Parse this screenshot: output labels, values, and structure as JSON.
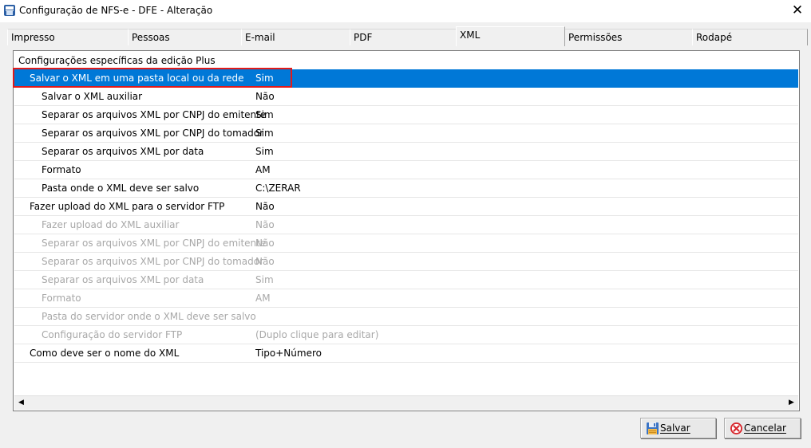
{
  "window": {
    "title": "Configuração de NFS-e - DFE - Alteração"
  },
  "tabs": [
    {
      "label": "Impresso"
    },
    {
      "label": "Pessoas"
    },
    {
      "label": "E-mail"
    },
    {
      "label": "PDF"
    },
    {
      "label": "XML"
    },
    {
      "label": "Permissões"
    },
    {
      "label": "Rodapé"
    }
  ],
  "active_tab": "XML",
  "panel": {
    "title": "Configurações específicas da edição Plus",
    "rows": [
      {
        "label": "Salvar o XML em uma pasta local ou da rede",
        "value": "Sim"
      },
      {
        "label": "Salvar o XML auxiliar",
        "value": "Não"
      },
      {
        "label": "Separar os arquivos XML por CNPJ do emitente",
        "value": "Sim"
      },
      {
        "label": "Separar os arquivos XML por CNPJ do tomador",
        "value": "Sim"
      },
      {
        "label": "Separar os arquivos XML por data",
        "value": "Sim"
      },
      {
        "label": "Formato",
        "value": "AM"
      },
      {
        "label": "Pasta onde o XML deve ser salvo",
        "value": "C:\\ZERAR"
      },
      {
        "label": "Fazer upload do XML para o servidor FTP",
        "value": "Não"
      },
      {
        "label": "Fazer upload do XML auxiliar",
        "value": "Não"
      },
      {
        "label": "Separar os arquivos XML por CNPJ do emitente",
        "value": "Não"
      },
      {
        "label": "Separar os arquivos XML por CNPJ do tomador",
        "value": "Não"
      },
      {
        "label": "Separar os arquivos XML por data",
        "value": "Sim"
      },
      {
        "label": "Formato",
        "value": "AM"
      },
      {
        "label": "Pasta do servidor onde o XML deve ser salvo",
        "value": ""
      },
      {
        "label": "Configuração do servidor FTP",
        "value": "(Duplo clique para editar)"
      },
      {
        "label": "Como deve ser o nome do XML",
        "value": "Tipo+Número"
      }
    ]
  },
  "buttons": {
    "save_label": "Salvar",
    "cancel_label": "Cancelar"
  },
  "colors": {
    "selection": "#0078d7",
    "highlight_border": "#e01a1a",
    "disabled_text": "#a8a8a8"
  },
  "icons": {
    "app": "app-icon",
    "close": "close-icon",
    "save": "floppy-disk-icon",
    "cancel": "cancel-icon",
    "scroll_left": "arrow-left-icon",
    "scroll_right": "arrow-right-icon"
  }
}
